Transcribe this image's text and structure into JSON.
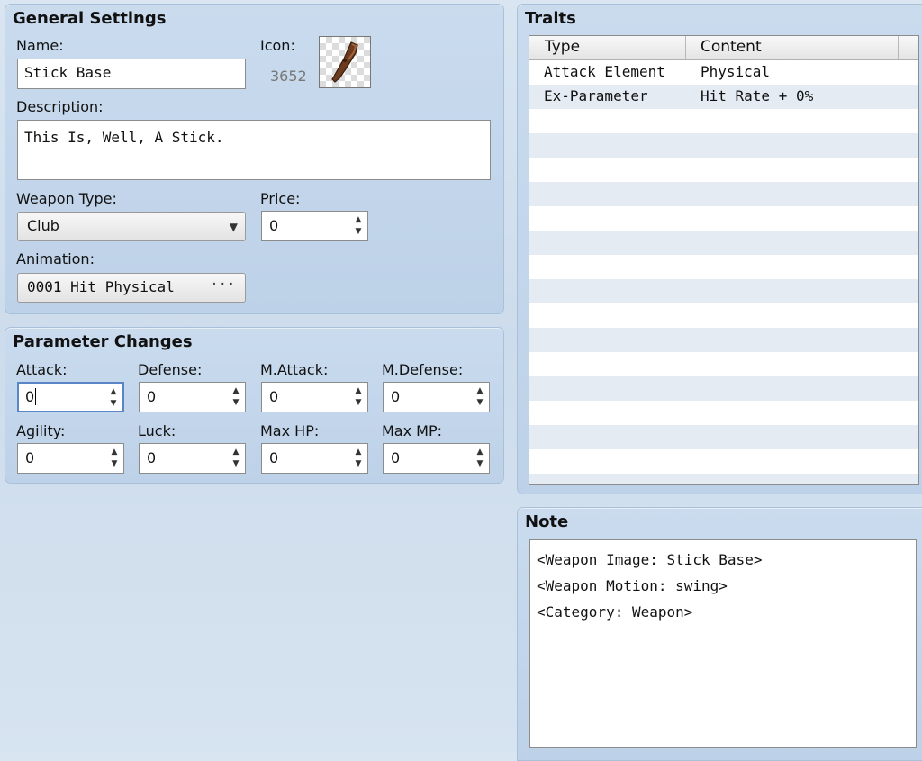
{
  "general": {
    "title": "General Settings",
    "name_label": "Name:",
    "name_value": "Stick Base",
    "icon_label": "Icon:",
    "icon_index": "3652",
    "description_label": "Description:",
    "description_value": "This Is, Well, A Stick.",
    "weapon_type_label": "Weapon Type:",
    "weapon_type_value": "Club",
    "price_label": "Price:",
    "price_value": "0",
    "animation_label": "Animation:",
    "animation_value": "0001 Hit Physical"
  },
  "params": {
    "title": "Parameter Changes",
    "attack": {
      "label": "Attack:",
      "value": "0"
    },
    "defense": {
      "label": "Defense:",
      "value": "0"
    },
    "mattack": {
      "label": "M.Attack:",
      "value": "0"
    },
    "mdefense": {
      "label": "M.Defense:",
      "value": "0"
    },
    "agility": {
      "label": "Agility:",
      "value": "0"
    },
    "luck": {
      "label": "Luck:",
      "value": "0"
    },
    "maxhp": {
      "label": "Max HP:",
      "value": "0"
    },
    "maxmp": {
      "label": "Max MP:",
      "value": "0"
    }
  },
  "traits": {
    "title": "Traits",
    "col_type": "Type",
    "col_content": "Content",
    "rows": [
      {
        "type": "Attack Element",
        "content": "Physical"
      },
      {
        "type": "Ex-Parameter",
        "content": "Hit Rate + 0%"
      }
    ]
  },
  "note": {
    "title": "Note",
    "lines": [
      "<Weapon Image: Stick Base>",
      "<Weapon Motion: swing>",
      "<Category: Weapon>"
    ]
  },
  "icons": {
    "dropdown": "chevron-down-icon",
    "ellipsis": "ellipsis-icon",
    "spin": "spin-arrows-icon",
    "weapon": "club-weapon-icon"
  },
  "colors": {
    "panel": "#c5d7ec",
    "focus": "#5a86c8"
  }
}
